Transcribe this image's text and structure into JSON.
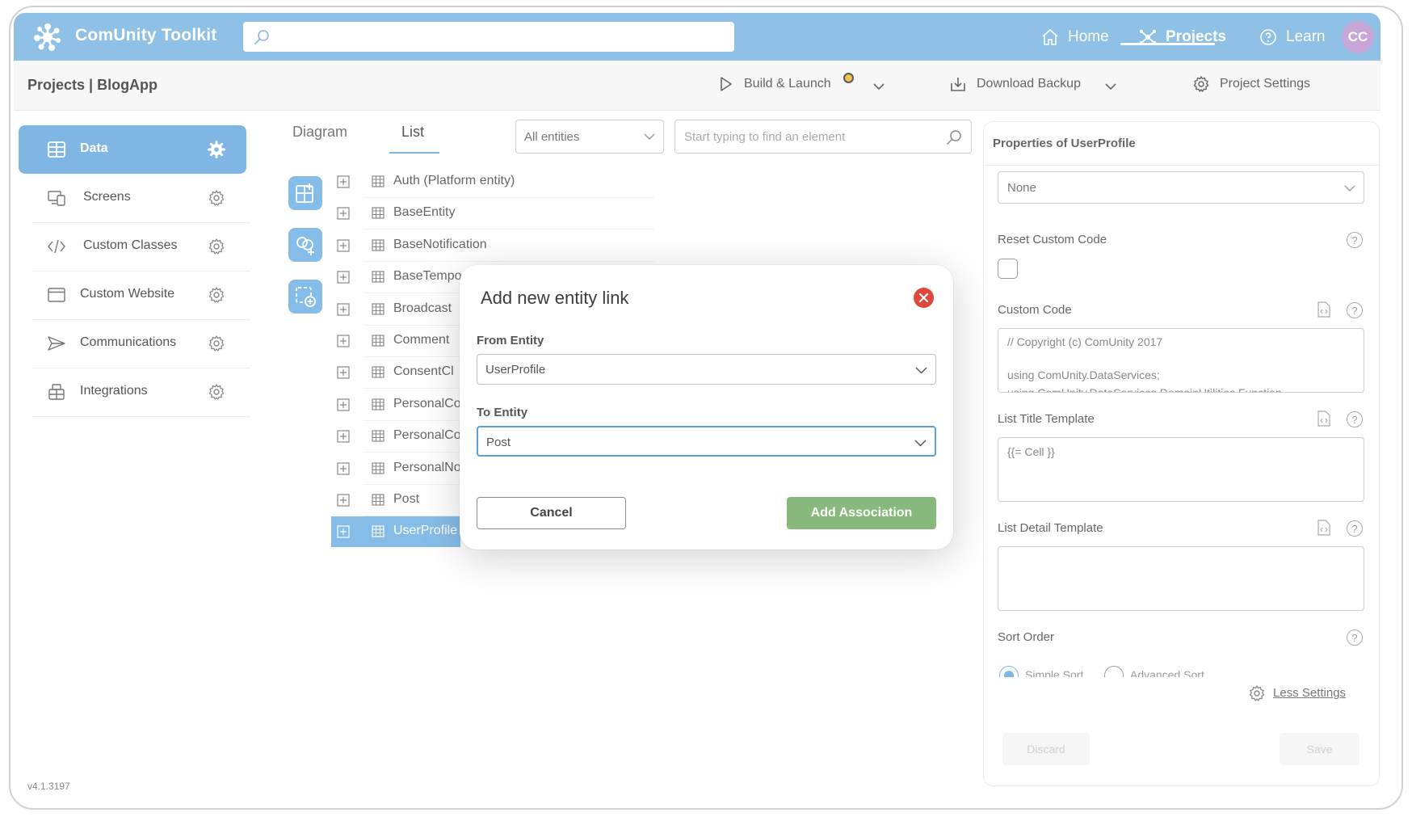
{
  "app": {
    "name": "ComUnity Toolkit",
    "search_placeholder": "",
    "version": "v4.1.3197"
  },
  "nav": {
    "home": "Home",
    "projects": "Projects",
    "learn": "Learn",
    "avatar_initials": "CC"
  },
  "subheader": {
    "breadcrumb": "Projects | BlogApp",
    "build_launch": "Build & Launch",
    "download_backup": "Download Backup",
    "project_settings": "Project Settings"
  },
  "sidebar": {
    "items": [
      {
        "label": "Data",
        "icon": "table-icon",
        "active": true
      },
      {
        "label": "Screens",
        "icon": "screens-icon"
      },
      {
        "label": "Custom Classes",
        "icon": "code-icon"
      },
      {
        "label": "Custom Website",
        "icon": "window-icon"
      },
      {
        "label": "Communications",
        "icon": "send-icon"
      },
      {
        "label": "Integrations",
        "icon": "integrations-icon"
      }
    ]
  },
  "main": {
    "tabs": [
      {
        "label": "Diagram"
      },
      {
        "label": "List",
        "active": true
      }
    ],
    "filter_value": "All entities",
    "find_placeholder": "Start typing to find an element",
    "entities": [
      "Auth (Platform entity)",
      "BaseEntity",
      "BaseNotification",
      "BaseTempo",
      "Broadcast",
      "Comment",
      "ConsentCl",
      "PersonalCo",
      "PersonalCo",
      "PersonalNo",
      "Post",
      "UserProfile"
    ],
    "selected_entity": "UserProfile"
  },
  "properties": {
    "title": "Properties of UserProfile",
    "select_value": "None",
    "reset_custom_code_label": "Reset Custom Code",
    "custom_code_label": "Custom Code",
    "custom_code_lines": [
      "// Copyright (c) ComUnity 2017",
      "",
      "using ComUnity.DataServices;",
      "using ComUnity.DataServices.DomainUtilities.Function"
    ],
    "list_title_template_label": "List Title Template",
    "list_title_template_value": "{{= Cell }}",
    "list_detail_template_label": "List Detail Template",
    "sort_order_label": "Sort Order",
    "sort_simple": "Simple Sort",
    "sort_advanced": "Advanced Sort",
    "less_settings": "Less Settings",
    "discard": "Discard",
    "save": "Save",
    "help_glyph": "?"
  },
  "modal": {
    "title": "Add new entity link",
    "from_label": "From Entity",
    "from_value": "UserProfile",
    "to_label": "To Entity",
    "to_value": "Post",
    "cancel": "Cancel",
    "add": "Add Association"
  },
  "colors": {
    "topbar": "#8fc0e5",
    "accent": "#7fb6e4",
    "add_button": "#88b97c",
    "close_button": "#e0463a",
    "status_dot": "#f2c14e"
  }
}
